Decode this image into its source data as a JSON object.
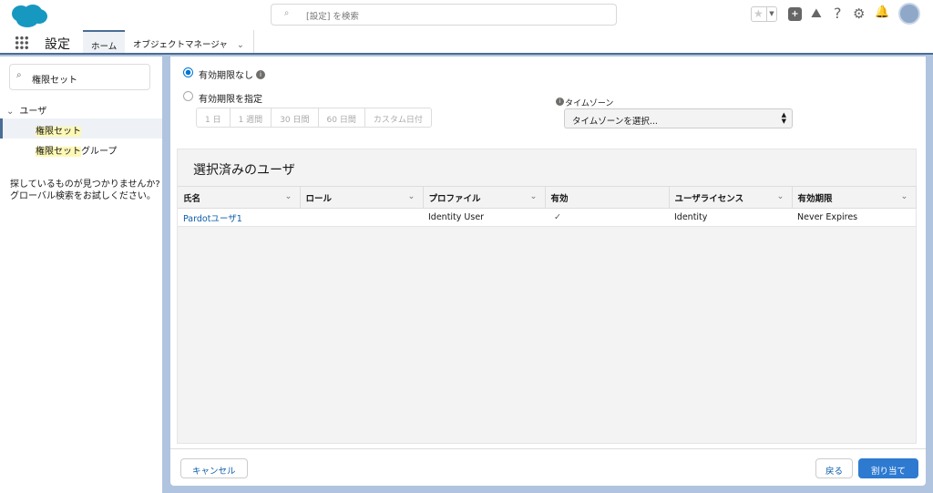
{
  "header": {
    "search_placeholder": "[設定] を検索"
  },
  "nav": {
    "app_name": "設定",
    "tabs": [
      {
        "label": "ホーム"
      },
      {
        "label": "オブジェクトマネージャ"
      }
    ]
  },
  "sidebar": {
    "search_value": "権限セット",
    "group": "ユーザ",
    "items": [
      {
        "label": "権限セット"
      },
      {
        "label": "権限セットグループ",
        "highlight": "権限セット",
        "rest": "グループ"
      }
    ],
    "help_line1": "探しているものが見つかりませんか?",
    "help_line2": "グローバル検索をお試しください。"
  },
  "expiry": {
    "no_expiry": "有効期限なし",
    "specify": "有効期限を指定",
    "durations": [
      "1 日",
      "1 週間",
      "30 日間",
      "60 日間",
      "カスタム日付"
    ],
    "timezone_label": "タイムゾーン",
    "timezone_value": "タイムゾーンを選択..."
  },
  "table": {
    "title": "選択済みのユーザ",
    "columns": [
      "氏名",
      "ロール",
      "プロファイル",
      "有効",
      "ユーザライセンス",
      "有効期限"
    ],
    "rows": [
      {
        "name": "Pardotユーザ1",
        "role": "",
        "profile": "Identity User",
        "active": "✓",
        "license": "Identity",
        "expires": "Never Expires"
      }
    ]
  },
  "footer": {
    "cancel": "キャンセル",
    "back": "戻る",
    "assign": "割り当て"
  },
  "colors": {
    "brand": "#0176d3",
    "link": "#0b5cab",
    "highlight": "#fdf8b5"
  }
}
